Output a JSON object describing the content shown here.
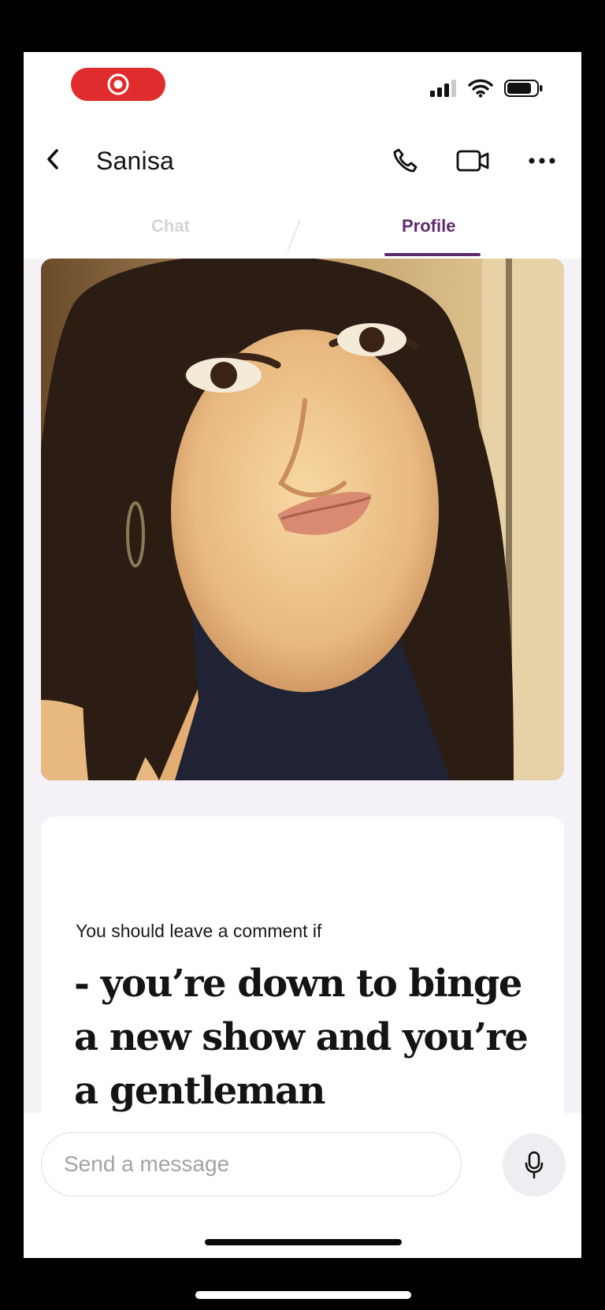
{
  "status_bar": {
    "icons": [
      "screen-record-icon",
      "signal-icon",
      "wifi-icon",
      "battery-icon"
    ]
  },
  "header": {
    "title": "Sanisa",
    "icons": [
      "back-chevron-icon",
      "phone-icon",
      "video-call-icon",
      "more-icon"
    ]
  },
  "tabs": [
    {
      "label": "Chat",
      "active": false
    },
    {
      "label": "Profile",
      "active": true
    }
  ],
  "profile": {
    "prompt_label": "You should leave a comment if",
    "prompt_answer": "- you’re down to binge a new show and you’re a gentleman"
  },
  "composer": {
    "placeholder": "Send a message",
    "value": ""
  },
  "colors": {
    "accent": "#5e2a6f",
    "record": "#e02c2c"
  }
}
